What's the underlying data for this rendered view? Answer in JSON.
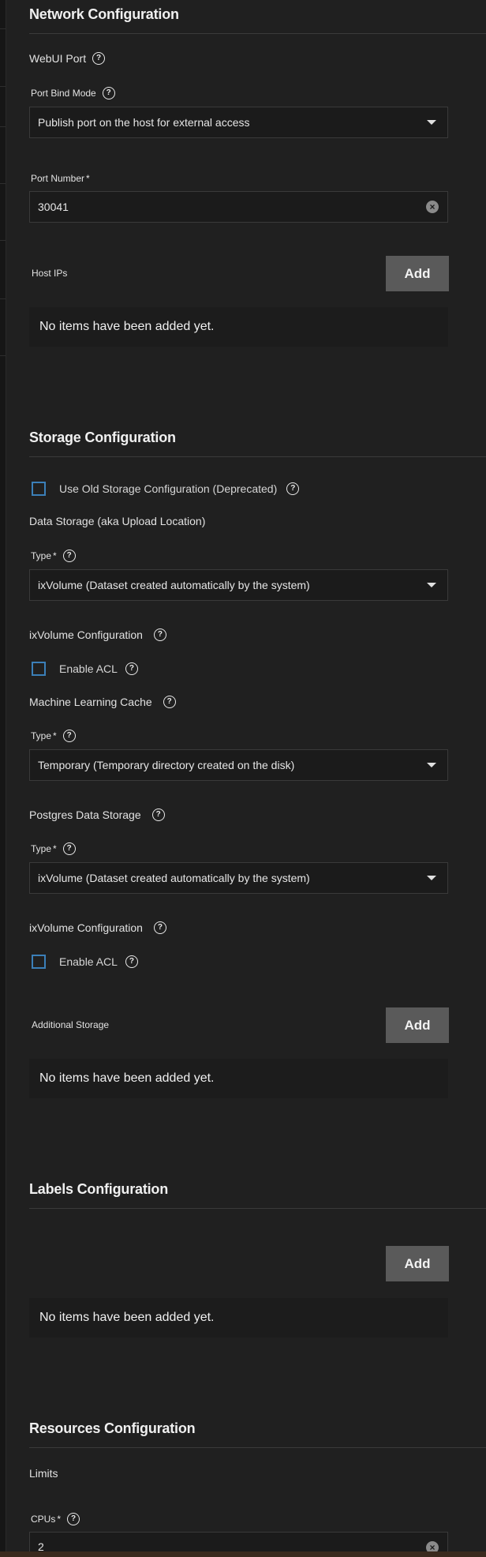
{
  "network": {
    "title": "Network Configuration",
    "webui_port_label": "WebUI Port",
    "port_bind_mode_label": "Port Bind Mode",
    "port_bind_mode_value": "Publish port on the host for external access",
    "port_number_label": "Port Number",
    "port_number_value": "30041",
    "host_ips_label": "Host IPs",
    "add_label": "Add",
    "empty_text": "No items have been added yet."
  },
  "storage": {
    "title": "Storage Configuration",
    "use_old_label": "Use Old Storage Configuration (Deprecated)",
    "data_storage_label": "Data Storage (aka Upload Location)",
    "type_label": "Type",
    "data_type_value": "ixVolume (Dataset created automatically by the system)",
    "ixvolume_config_label": "ixVolume Configuration",
    "enable_acl_label": "Enable ACL",
    "ml_cache_label": "Machine Learning Cache",
    "ml_type_value": "Temporary (Temporary directory created on the disk)",
    "postgres_label": "Postgres Data Storage",
    "postgres_type_value": "ixVolume (Dataset created automatically by the system)",
    "additional_storage_label": "Additional Storage",
    "add_label": "Add",
    "empty_text": "No items have been added yet."
  },
  "labels": {
    "title": "Labels Configuration",
    "add_label": "Add",
    "empty_text": "No items have been added yet."
  },
  "resources": {
    "title": "Resources Configuration",
    "limits_label": "Limits",
    "cpus_label": "CPUs",
    "cpus_value": "2"
  },
  "required_marker": "*",
  "help_glyph": "?",
  "clear_glyph": "×",
  "colors": {
    "background": "#202020",
    "checkbox_border": "#3b7fb8",
    "button": "#5a5a5a"
  }
}
